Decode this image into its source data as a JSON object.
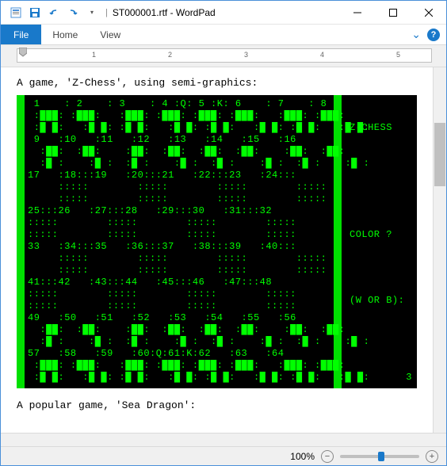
{
  "window": {
    "filename": "ST000001.rtf",
    "appname": "WordPad",
    "title_sep": " - "
  },
  "qat": {
    "dropdown_glyph": "▾"
  },
  "ribbon": {
    "file": "File",
    "home": "Home",
    "view": "View",
    "expand_glyph": "⌄",
    "help": "?"
  },
  "ruler": {
    "marks": [
      "1",
      "2",
      "3",
      "4",
      "5"
    ]
  },
  "document": {
    "line1": "A game, 'Z-Chess', using semi-graphics:",
    "line2": "A popular game, 'Sea Dragon':"
  },
  "zchess": {
    "title": "Z-CHESS",
    "prompt1": "COLOR ?",
    "prompt2": "(W OR B):",
    "page": "3",
    "board_rows": [
      " 1    : 2    : 3    : 4 :Q: 5 :K: 6    : 7    : 8",
      " :███: :███:   :███: :███: :███: :███:   :███: :███:",
      " :█ █:   :█ █: :█ █:   :█ █: :█ █:   :█ █: :█ █:   :█ █:",
      " 9   :10   :11   :12   :13   :14   :15   :16",
      "  :██:  :██:    :██:  :██:  :██:  :██:    :██:  :██:",
      "  :█ :    :█ :  :█ :    :█ :  :█ :    :█ :  :█ :    :█ :",
      "17   :18:::19   :20:::21   :22:::23   :24:::",
      "     :::::        :::::        :::::        :::::",
      "     :::::        :::::        :::::        :::::",
      "25:::26   :27:::28   :29:::30   :31:::32",
      ":::::        :::::        :::::        :::::",
      ":::::        :::::        :::::        :::::",
      "33   :34:::35   :36:::37   :38:::39   :40:::",
      "     :::::        :::::        :::::        :::::",
      "     :::::        :::::        :::::        :::::",
      "41:::42   :43:::44   :45:::46   :47:::48",
      ":::::        :::::        :::::        :::::",
      ":::::        :::::        :::::        :::::",
      "49   :50   :51   :52   :53   :54   :55   :56",
      "  :██:  :██:    :██:  :██:  :██:  :██:    :██:  :██:",
      "  :█ :    :█ :  :█ :    :█ :  :█ :    :█ :  :█ :    :█ :",
      "57   :58   :59   :60:Q:61:K:62   :63   :64",
      " :███: :███:   :███: :███: :███: :███:   :███: :███:",
      " :█ █:   :█ █: :█ █:   :█ █: :█ █:   :█ █: :█ █:   :█ █:"
    ]
  },
  "status": {
    "zoom": "100%",
    "minus": "−",
    "plus": "+"
  }
}
